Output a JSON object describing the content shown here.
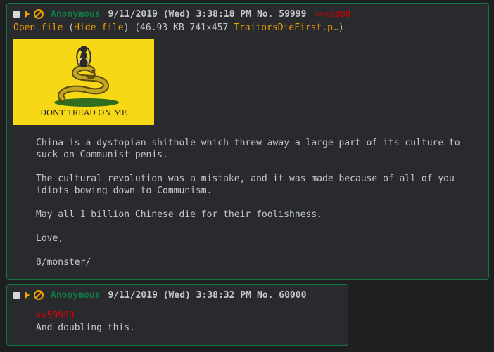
{
  "posts": [
    {
      "name": "Anonymous",
      "date": "9/11/2019 (Wed) 3:38:18 PM",
      "no_label": "No.",
      "no": "59999",
      "backlink": ">>60000",
      "file": {
        "open_label": "Open file",
        "hide_label": "Hide file",
        "size_dims": "(46.93 KB 741x457",
        "filename": "TraitorsDieFirst.p…",
        "close_paren": ")",
        "image_caption": "DONT TREAD ON ME"
      },
      "body": "China is a dystopian shithole which threw away a large part of its culture to suck on Communist penis.\n\nThe cultural revolution was a mistake, and it was made because of all of you idiots bowing down to Communism.\n\nMay all 1 billion Chinese die for their foolishness.\n\nLove,\n\n8/monster/"
    },
    {
      "name": "Anonymous",
      "date": "9/11/2019 (Wed) 3:38:32 PM",
      "no_label": "No.",
      "no": "60000",
      "quote": ">>59999",
      "body": "And doubling this."
    }
  ],
  "colors": {
    "name": "#117743",
    "link": "#f0a000",
    "quote": "#dd0000",
    "background": "#1d1f21",
    "post_bg": "#282a2e"
  },
  "icons": [
    "checkbox-icon",
    "expand-triangle-icon",
    "hide-post-icon"
  ]
}
